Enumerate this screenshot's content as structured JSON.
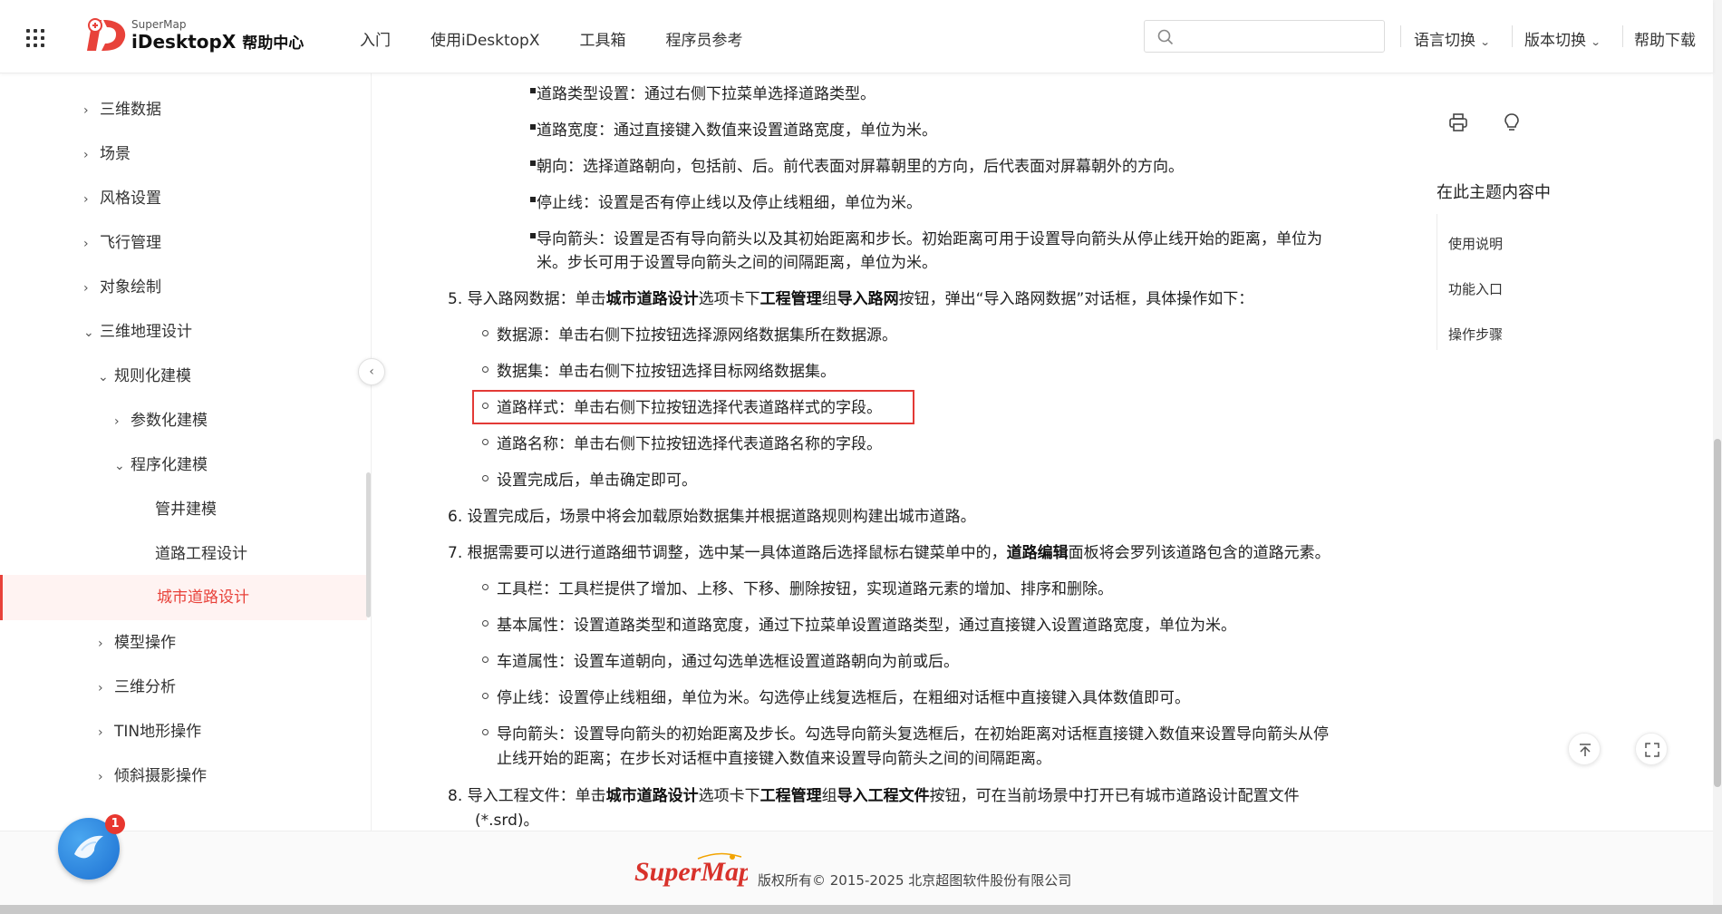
{
  "header": {
    "brand_small": "SuperMap",
    "brand_name": "iDesktopX",
    "brand_suffix": "帮助中心",
    "nav": [
      "入门",
      "使用iDesktopX",
      "工具箱",
      "程序员参考"
    ],
    "search_placeholder": "",
    "language_switch": "语言切换",
    "version_switch": "版本切换",
    "help_download": "帮助下载"
  },
  "sidebar": {
    "items": [
      {
        "label": "三维数据",
        "arrow": "›"
      },
      {
        "label": "场景",
        "arrow": "›"
      },
      {
        "label": "风格设置",
        "arrow": "›"
      },
      {
        "label": "飞行管理",
        "arrow": "›"
      },
      {
        "label": "对象绘制",
        "arrow": "›"
      },
      {
        "label": "三维地理设计",
        "arrow": "⌄"
      },
      {
        "label": "规则化建模",
        "arrow": "⌄"
      },
      {
        "label": "参数化建模",
        "arrow": "›"
      },
      {
        "label": "程序化建模",
        "arrow": "⌄"
      },
      {
        "label": "管井建模",
        "arrow": ""
      },
      {
        "label": "道路工程设计",
        "arrow": ""
      },
      {
        "label": "城市道路设计",
        "arrow": ""
      },
      {
        "label": "模型操作",
        "arrow": "›"
      },
      {
        "label": "三维分析",
        "arrow": "›"
      },
      {
        "label": "TIN地形操作",
        "arrow": "›"
      },
      {
        "label": "倾斜摄影操作",
        "arrow": "›"
      }
    ],
    "active": "城市道路设计",
    "collapse_glyph": "‹"
  },
  "content": {
    "b1": "道路类型设置：通过右侧下拉菜单选择道路类型。",
    "b2": "道路宽度：通过直接键入数值来设置道路宽度，单位为米。",
    "b3": "朝向：选择道路朝向，包括前、后。前代表面对屏幕朝里的方向，后代表面对屏幕朝外的方向。",
    "b4": "停止线：设置是否有停止线以及停止线粗细，单位为米。",
    "b5a": "导向箭头：设置是否有导向箭头以及其初始距离和步长。初始距离可用于设置导向箭头从停止线开始的距离，单位为",
    "b5b": "米。步长可用于设置导向箭头之间的间隔距离，单位为米。",
    "s5": {
      "num": "5.",
      "p1": "导入路网数据：单击",
      "k1": "城市道路设计",
      "p2": "选项卡下",
      "k2": "工程管理",
      "p3": "组",
      "k3": "导入路网",
      "p4": "按钮，弹出“导入路网数据”对话框，具体操作如下："
    },
    "c1": "数据源：单击右侧下拉按钮选择源网络数据集所在数据源。",
    "c2": "数据集：单击右侧下拉按钮选择目标网络数据集。",
    "c3": "道路样式：单击右侧下拉按钮选择代表道路样式的字段。",
    "c4": "道路名称：单击右侧下拉按钮选择代表道路名称的字段。",
    "c5": "设置完成后，单击确定即可。",
    "s6": {
      "num": "6.",
      "text": "设置完成后，场景中将会加载原始数据集并根据道路规则构建出城市道路。"
    },
    "s7": {
      "num": "7.",
      "p1": "根据需要可以进行道路细节调整，选中某一具体道路后选择鼠标右键菜单中的，",
      "k1": "道路编辑",
      "p2": "面板将会罗列该道路包含的道路元素。"
    },
    "d1": "工具栏：工具栏提供了增加、上移、下移、删除按钮，实现道路元素的增加、排序和删除。",
    "d2": "基本属性：设置道路类型和道路宽度，通过下拉菜单设置道路类型，通过直接键入设置道路宽度，单位为米。",
    "d3": "车道属性：设置车道朝向，通过勾选单选框设置道路朝向为前或后。",
    "d4": "停止线：设置停止线粗细，单位为米。勾选停止线复选框后，在粗细对话框中直接键入具体数值即可。",
    "d5a": "导向箭头：设置导向箭头的初始距离及步长。勾选导向箭头复选框后，在初始距离对话框直接键入数值来设置导向箭头从停",
    "d5b": "止线开始的距离；在步长对话框中直接键入数值来设置导向箭头之间的间隔距离。",
    "s8": {
      "num": "8.",
      "p1": "导入工程文件：单击",
      "k1": "城市道路设计",
      "p2": "选项卡下",
      "k2": "工程管理",
      "p3": "组",
      "k3": "导入工程文件",
      "p4": "按钮，可在当前场景中打开已有城市道路设计配置文件",
      "p5": "(*.srd)。"
    }
  },
  "toc": {
    "title": "在此主题内容中",
    "items": [
      "使用说明",
      "功能入口",
      "操作步骤"
    ]
  },
  "footer": {
    "logo_text": "SuperMap",
    "copyright": "版权所有© 2015-2025 北京超图软件股份有限公司"
  },
  "chat": {
    "badge": "1"
  },
  "colors": {
    "accent": "#e8423a",
    "active_bg": "#fff3f2",
    "highlight_border": "#e33a36",
    "chat_blue": "#2b86e0"
  }
}
